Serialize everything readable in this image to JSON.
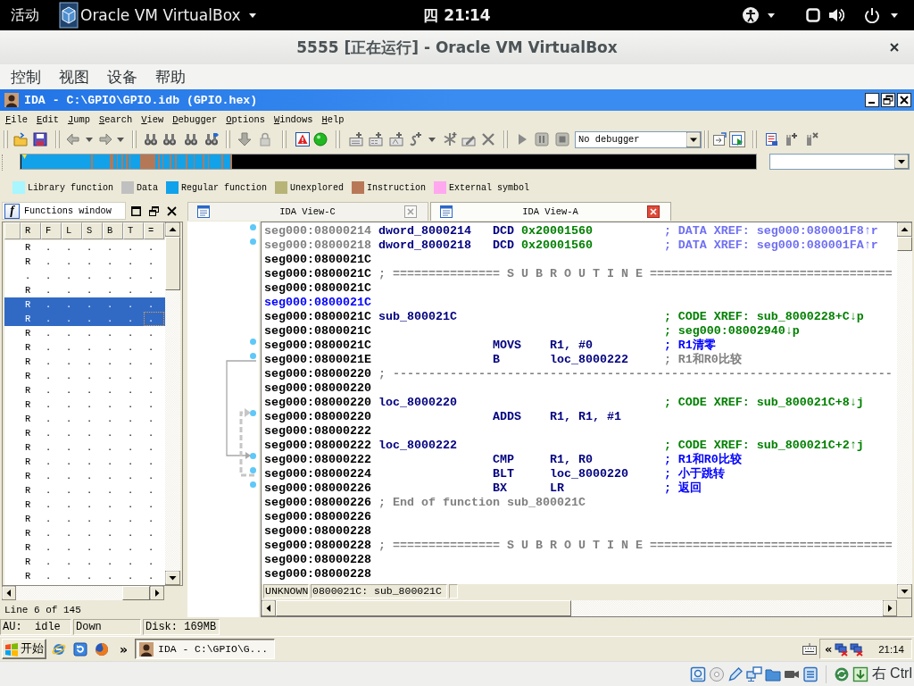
{
  "top_bar": {
    "activities": "活动",
    "app_menu": "Oracle VM VirtualBox",
    "clock": "四 21∶14"
  },
  "window": {
    "title": "5555 [正在运行] - Oracle VM VirtualBox",
    "menu": [
      "控制",
      "视图",
      "设备",
      "帮助"
    ]
  },
  "ida": {
    "title": "IDA - C:\\GPIO\\GPIO.idb (GPIO.hex)",
    "menu": [
      "File",
      "Edit",
      "Jump",
      "Search",
      "View",
      "Debugger",
      "Options",
      "Windows",
      "Help"
    ],
    "debugger_combo": "No debugger",
    "legend": [
      {
        "label": "Library function",
        "color": "#a8f6ff"
      },
      {
        "label": "Data",
        "color": "#c0c0c0"
      },
      {
        "label": "Regular function",
        "color": "#10a2ea"
      },
      {
        "label": "Unexplored",
        "color": "#b8b478"
      },
      {
        "label": "Instruction",
        "color": "#b87858"
      },
      {
        "label": "External symbol",
        "color": "#ffa8f0"
      }
    ],
    "functions_window": {
      "icon": "f",
      "title": "Functions window",
      "columns": [
        "R",
        "F",
        "L",
        "S",
        "B",
        "T",
        "="
      ],
      "rows": [
        {
          "flags": [
            "R",
            ".",
            ".",
            ".",
            ".",
            ".",
            "."
          ],
          "selected": false,
          "focused": false
        },
        {
          "flags": [
            "R",
            ".",
            ".",
            ".",
            ".",
            ".",
            "."
          ],
          "selected": false,
          "focused": false
        },
        {
          "flags": [
            ".",
            ".",
            ".",
            ".",
            ".",
            ".",
            "."
          ],
          "selected": false,
          "focused": false
        },
        {
          "flags": [
            "R",
            ".",
            ".",
            ".",
            ".",
            ".",
            "."
          ],
          "selected": false,
          "focused": false
        },
        {
          "flags": [
            "R",
            ".",
            ".",
            ".",
            ".",
            ".",
            "."
          ],
          "selected": true,
          "focused": false
        },
        {
          "flags": [
            "R",
            ".",
            ".",
            ".",
            ".",
            ".",
            "."
          ],
          "selected": true,
          "focused": true
        },
        {
          "flags": [
            "R",
            ".",
            ".",
            ".",
            ".",
            ".",
            "."
          ],
          "selected": false,
          "focused": false
        },
        {
          "flags": [
            "R",
            ".",
            ".",
            ".",
            ".",
            ".",
            "."
          ],
          "selected": false,
          "focused": false
        },
        {
          "flags": [
            "R",
            ".",
            ".",
            ".",
            ".",
            ".",
            "."
          ],
          "selected": false,
          "focused": false
        },
        {
          "flags": [
            "R",
            ".",
            ".",
            ".",
            ".",
            ".",
            "."
          ],
          "selected": false,
          "focused": false
        },
        {
          "flags": [
            "R",
            ".",
            ".",
            ".",
            ".",
            ".",
            "."
          ],
          "selected": false,
          "focused": false
        },
        {
          "flags": [
            "R",
            ".",
            ".",
            ".",
            ".",
            ".",
            "."
          ],
          "selected": false,
          "focused": false
        },
        {
          "flags": [
            "R",
            ".",
            ".",
            ".",
            ".",
            ".",
            "."
          ],
          "selected": false,
          "focused": false
        },
        {
          "flags": [
            "R",
            ".",
            ".",
            ".",
            ".",
            ".",
            "."
          ],
          "selected": false,
          "focused": false
        },
        {
          "flags": [
            "R",
            ".",
            ".",
            ".",
            ".",
            ".",
            "."
          ],
          "selected": false,
          "focused": false
        },
        {
          "flags": [
            "R",
            ".",
            ".",
            ".",
            ".",
            ".",
            "."
          ],
          "selected": false,
          "focused": false
        },
        {
          "flags": [
            "R",
            ".",
            ".",
            ".",
            ".",
            ".",
            "."
          ],
          "selected": false,
          "focused": false
        },
        {
          "flags": [
            "R",
            ".",
            ".",
            ".",
            ".",
            ".",
            "."
          ],
          "selected": false,
          "focused": false
        },
        {
          "flags": [
            "R",
            ".",
            ".",
            ".",
            ".",
            ".",
            "."
          ],
          "selected": false,
          "focused": false
        },
        {
          "flags": [
            "R",
            ".",
            ".",
            ".",
            ".",
            ".",
            "."
          ],
          "selected": false,
          "focused": false
        },
        {
          "flags": [
            "R",
            ".",
            ".",
            ".",
            ".",
            ".",
            "."
          ],
          "selected": false,
          "focused": false
        },
        {
          "flags": [
            "R",
            ".",
            ".",
            ".",
            ".",
            ".",
            "."
          ],
          "selected": false,
          "focused": false
        },
        {
          "flags": [
            "R",
            ".",
            ".",
            ".",
            ".",
            ".",
            "."
          ],
          "selected": false,
          "focused": false
        },
        {
          "flags": [
            "R",
            ".",
            ".",
            ".",
            ".",
            ".",
            "."
          ],
          "selected": false,
          "focused": false
        }
      ],
      "status": "Line 6 of 145"
    },
    "tabs": [
      {
        "label": "IDA View-C",
        "selected": false
      },
      {
        "label": "IDA View-A",
        "selected": true
      }
    ],
    "listing": {
      "lines": [
        {
          "address": "seg000:08000214",
          "kind": "data",
          "selected": false,
          "label": "dword_8000214",
          "mnemonic": "DCD",
          "operands": "0x20001560",
          "comment": {
            "text": "; DATA XREF: seg000:080001F8↑r",
            "kind": "data_xref"
          }
        },
        {
          "address": "seg000:08000218",
          "kind": "data",
          "selected": false,
          "label": "dword_8000218",
          "mnemonic": "DCD",
          "operands": "0x20001560",
          "comment": {
            "text": "; DATA XREF: seg000:080001FA↑r",
            "kind": "data_xref"
          }
        },
        {
          "address": "seg000:0800021C",
          "kind": "code",
          "selected": false
        },
        {
          "address": "seg000:0800021C",
          "kind": "code",
          "selected": false,
          "note": "; =============== S U B R O U T I N E =================================="
        },
        {
          "address": "seg000:0800021C",
          "kind": "code",
          "selected": false
        },
        {
          "address": "seg000:0800021C",
          "kind": "code",
          "selected": true
        },
        {
          "address": "seg000:0800021C",
          "kind": "code",
          "selected": false,
          "label": "sub_800021C",
          "comment": {
            "text": "; CODE XREF: sub_8000228+C↓p",
            "kind": "code_xref"
          }
        },
        {
          "address": "seg000:0800021C",
          "kind": "code",
          "selected": false,
          "comment": {
            "text": "; seg000:08002940↓p",
            "kind": "code_xref"
          }
        },
        {
          "address": "seg000:0800021C",
          "kind": "code",
          "selected": false,
          "mnemonic": "MOVS",
          "operands": "R1, #0",
          "comment": {
            "text": "; R1清零",
            "kind": "user"
          }
        },
        {
          "address": "seg000:0800021E",
          "kind": "code",
          "selected": false,
          "mnemonic": "B",
          "operands": "loc_8000222",
          "comment": {
            "text": "; R1和R0比较",
            "kind": "auto"
          }
        },
        {
          "address": "seg000:08000220",
          "kind": "code",
          "selected": false,
          "note": "; ----------------------------------------------------------------------"
        },
        {
          "address": "seg000:08000220",
          "kind": "code",
          "selected": false
        },
        {
          "address": "seg000:08000220",
          "kind": "code",
          "selected": false,
          "label": "loc_8000220",
          "comment": {
            "text": "; CODE XREF: sub_800021C+8↓j",
            "kind": "code_xref"
          }
        },
        {
          "address": "seg000:08000220",
          "kind": "code",
          "selected": false,
          "mnemonic": "ADDS",
          "operands": "R1, R1, #1"
        },
        {
          "address": "seg000:08000222",
          "kind": "code",
          "selected": false
        },
        {
          "address": "seg000:08000222",
          "kind": "code",
          "selected": false,
          "label": "loc_8000222",
          "comment": {
            "text": "; CODE XREF: sub_800021C+2↑j",
            "kind": "code_xref"
          }
        },
        {
          "address": "seg000:08000222",
          "kind": "code",
          "selected": false,
          "mnemonic": "CMP",
          "operands": "R1, R0",
          "comment": {
            "text": "; R1和R0比较",
            "kind": "user"
          }
        },
        {
          "address": "seg000:08000224",
          "kind": "code",
          "selected": false,
          "mnemonic": "BLT",
          "operands": "loc_8000220",
          "comment": {
            "text": "; 小于跳转",
            "kind": "user"
          }
        },
        {
          "address": "seg000:08000226",
          "kind": "code",
          "selected": false,
          "mnemonic": "BX",
          "operands": "LR",
          "comment": {
            "text": "; 返回",
            "kind": "user"
          }
        },
        {
          "address": "seg000:08000226",
          "kind": "code",
          "selected": false,
          "note": "; End of function sub_800021C"
        },
        {
          "address": "seg000:08000226",
          "kind": "code",
          "selected": false
        },
        {
          "address": "seg000:08000228",
          "kind": "code",
          "selected": false
        },
        {
          "address": "seg000:08000228",
          "kind": "code",
          "selected": false,
          "note": "; =============== S U B R O U T I N E =================================="
        },
        {
          "address": "seg000:08000228",
          "kind": "code",
          "selected": false
        },
        {
          "address": "seg000:08000228",
          "kind": "code",
          "selected": false
        }
      ],
      "status": [
        "UNKNOWN",
        "0800021C: sub_800021C"
      ]
    },
    "status_bar": [
      "AU:  idle",
      "Down",
      "Disk: 169MB"
    ]
  },
  "taskbar": {
    "start": "开始",
    "more": "»",
    "task": "IDA - C:\\GPIO\\G...",
    "tray_toggle": "«",
    "clock": "21:14"
  },
  "vm_status_bar": {
    "host_key": "右 Ctrl"
  }
}
